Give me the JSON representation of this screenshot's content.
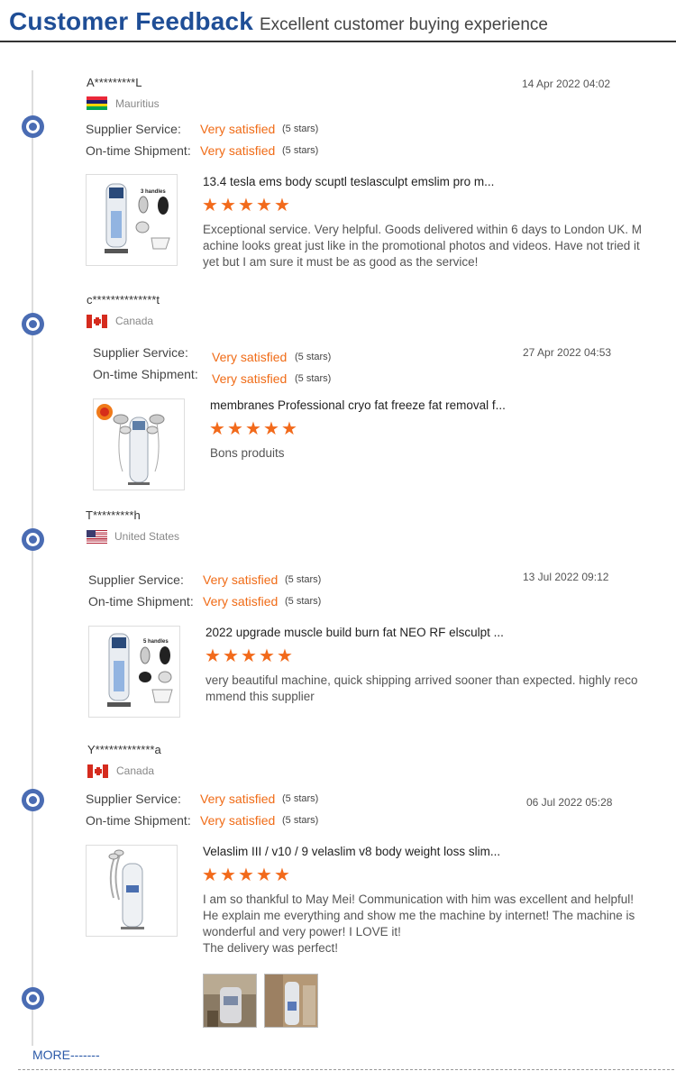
{
  "header": {
    "title": "Customer Feedback",
    "subtitle": "Excellent customer buying experience"
  },
  "labels": {
    "supplier_service": "Supplier Service:",
    "ontime_shipment": "On-time Shipment:"
  },
  "reviews": [
    {
      "buyer": "A*********L",
      "country": "Mauritius",
      "flag": "mauritius-flag",
      "date": "14 Apr 2022 04:02",
      "supplier_rating": "Very satisfied",
      "supplier_stars": "(5 stars)",
      "shipment_rating": "Very satisfied",
      "shipment_stars": "(5 stars)",
      "product_title": "13.4 tesla ems body scuptl teslasculpt emslim pro m...",
      "product_stars": 5,
      "comment_lines": [
        "Exceptional service. Very helpful. Goods delivered within 6 days to London UK. M",
        "achine looks great just like in the promotional photos and videos. Have not tried it",
        "yet but I am sure it must be as good as the service!"
      ],
      "thumb_label": "3 handles"
    },
    {
      "buyer": "c**************t",
      "country": "Canada",
      "flag": "canada-flag",
      "date": "27 Apr 2022 04:53",
      "supplier_rating": "Very satisfied",
      "supplier_stars": "(5 stars)",
      "shipment_rating": "Very satisfied",
      "shipment_stars": "(5 stars)",
      "product_title": "membranes Professional cryo fat freeze fat removal f...",
      "product_stars": 5,
      "comment_lines": [
        "Bons produits"
      ]
    },
    {
      "buyer": "T*********h",
      "country": "United States",
      "flag": "usa-flag",
      "date": "13 Jul 2022 09:12",
      "supplier_rating": "Very satisfied",
      "supplier_stars": "(5 stars)",
      "shipment_rating": "Very satisfied",
      "shipment_stars": "(5 stars)",
      "product_title": "2022 upgrade muscle build burn fat NEO RF elsculpt ...",
      "product_stars": 5,
      "comment_lines": [
        "very beautiful machine, quick shipping arrived sooner than expected. highly reco",
        "mmend this supplier"
      ],
      "thumb_label": "5 handles"
    },
    {
      "buyer": "Y*************a",
      "country": "Canada",
      "flag": "canada-flag",
      "date": "06 Jul 2022 05:28",
      "supplier_rating": "Very satisfied",
      "supplier_stars": "(5 stars)",
      "shipment_rating": "Very satisfied",
      "shipment_stars": "(5 stars)",
      "product_title": "Velaslim III / v10 / 9 velaslim v8 body weight loss slim...",
      "product_stars": 5,
      "comment_lines": [
        "I am so thankful to May Mei! Communication with him was excellent and helpful!",
        "He explain me everything and show me the machine by internet! The machine is",
        "wonderful and very power! I LOVE it!",
        "The delivery was perfect!"
      ]
    }
  ],
  "more_link": "MORE-------",
  "colors": {
    "title_blue": "#1f4e96",
    "accent_orange": "#f06b16",
    "timeline_dot": "#4a6cb3"
  }
}
